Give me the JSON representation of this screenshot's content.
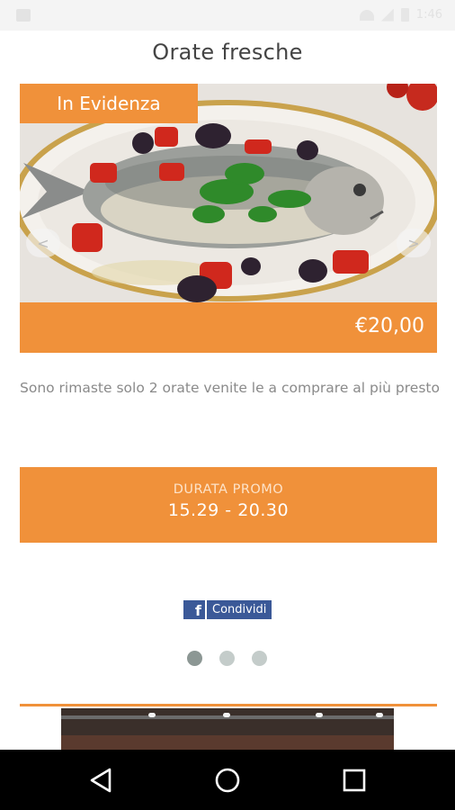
{
  "status_bar": {
    "time": "1:46"
  },
  "header": {
    "title": "Orate fresche"
  },
  "offer": {
    "badge": "In Evidenza",
    "price": "€20,00",
    "description": "Sono rimaste solo 2 orate venite le a comprare al più presto",
    "prev_arrow": "<",
    "next_arrow": ">",
    "image": "grilled-sea-bream-plate"
  },
  "promo": {
    "label": "DURATA PROMO",
    "time_range": "15.29 - 20.30"
  },
  "share": {
    "icon_glyph": "f",
    "label": "Condividi",
    "icon": "facebook-icon"
  },
  "pagination": {
    "pages": 3,
    "active": 1
  },
  "colors": {
    "accent": "#f0913a",
    "facebook": "#3b5998",
    "dot_active": "#8c9794",
    "dot_inactive": "#c4ccca"
  },
  "navigation": {
    "back": "back-icon",
    "home": "home-icon",
    "recents": "recents-icon"
  }
}
